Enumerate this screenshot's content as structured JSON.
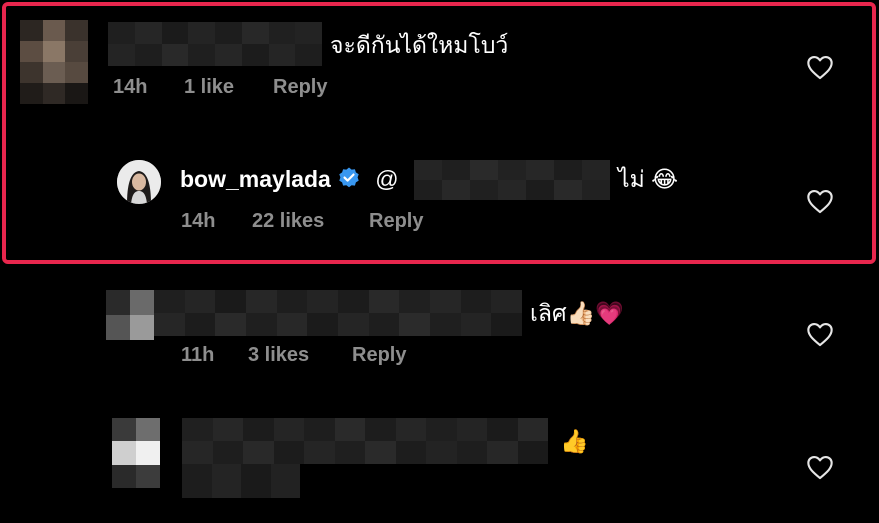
{
  "comments": [
    {
      "text": "จะดีกันได้ใหมโบว์",
      "time": "14h",
      "likes": "1 like",
      "reply": "Reply"
    },
    {
      "username": "bow_maylada",
      "mention": "@",
      "text": "ไม่ 😂",
      "time": "14h",
      "likes": "22 likes",
      "reply": "Reply"
    },
    {
      "text": "เลิศ👍🏻💗",
      "time": "11h",
      "likes": "3 likes",
      "reply": "Reply"
    },
    {
      "text": "👍"
    }
  ],
  "colors": {
    "highlight_border": "#e8264d",
    "meta_text": "#8e8e8e",
    "verified": "#3897f0"
  },
  "icons": [
    "heart-icon",
    "verified-badge-icon"
  ]
}
